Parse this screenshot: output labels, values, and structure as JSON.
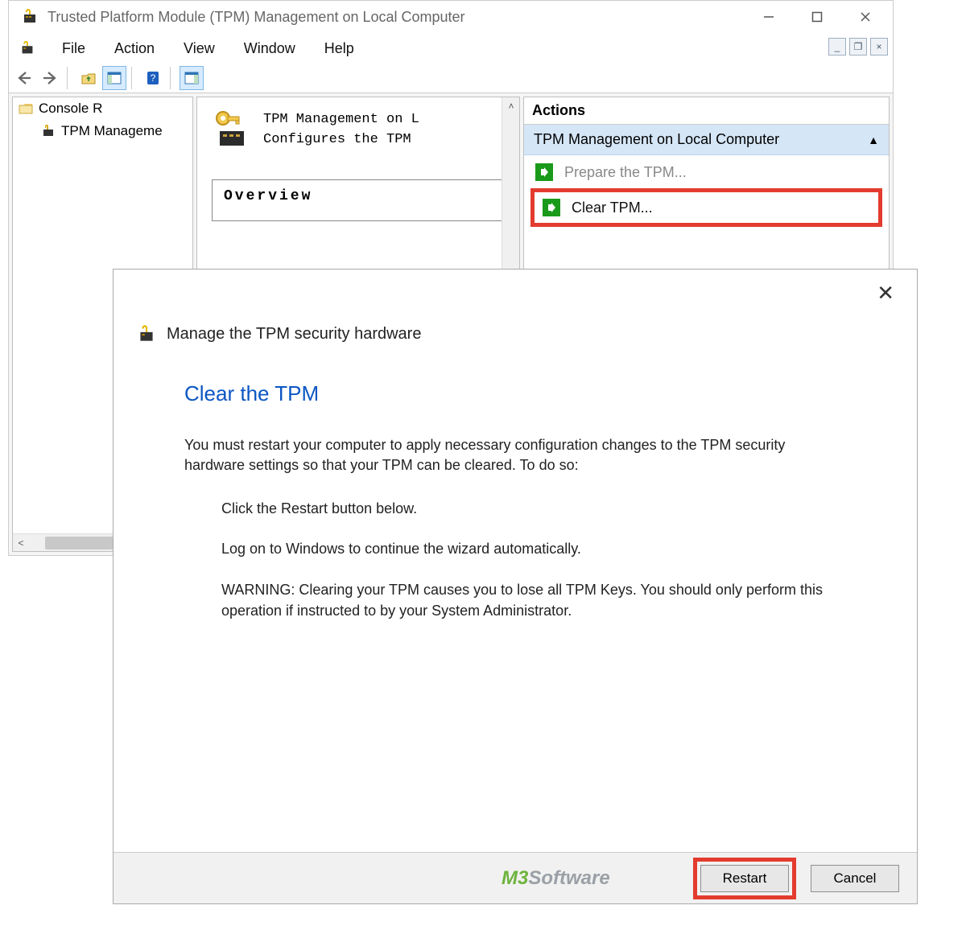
{
  "window": {
    "title": "Trusted Platform Module (TPM) Management on Local Computer"
  },
  "menu": {
    "file": "File",
    "action": "Action",
    "view": "View",
    "window": "Window",
    "help": "Help"
  },
  "tree": {
    "root": "Console R",
    "child": "TPM Manageme"
  },
  "center": {
    "line1": "TPM Management on L",
    "line2": "Configures the TPM",
    "overview_title": "Overview"
  },
  "actions": {
    "header": "Actions",
    "group": "TPM Management on Local Computer",
    "prepare": "Prepare the TPM...",
    "clear": "Clear TPM..."
  },
  "dialog": {
    "title": "Manage the TPM security hardware",
    "heading": "Clear the TPM",
    "para1": "You must restart your computer to apply necessary configuration changes to the TPM security hardware settings so that your TPM can be cleared. To do so:",
    "step1": "Click the Restart button below.",
    "step2": "Log on to Windows to continue the wizard automatically.",
    "step3": "WARNING: Clearing your TPM causes you to lose all TPM Keys. You should only perform this operation if instructed to by your System Administrator.",
    "restart": "Restart",
    "cancel": "Cancel",
    "watermark_a": "M3",
    "watermark_b": "Software"
  }
}
